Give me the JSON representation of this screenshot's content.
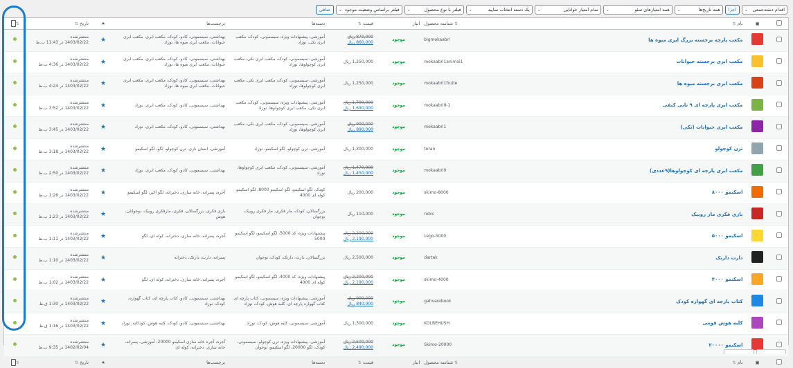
{
  "filters": {
    "bulk_action": "اقدام دسته‌جمعی",
    "apply": "اجرا",
    "dates": "همه تاریخ‌ها",
    "seo_scores": "همه امتیازهای سئو",
    "readability": "تمام امتیاز خوانایی",
    "category": "یک دسته انتخاب نمایید",
    "product_type": "فیلتر با نوع محصول",
    "stock_status": "فیلتر براساس وضعیت موجود",
    "filter_button": "صافی"
  },
  "columns": {
    "name": "نام",
    "sku": "شناسه محصول",
    "stock": "انبار",
    "price": "قیمت",
    "categories": "دسته‌ها",
    "tags": "برچسب‌ها",
    "date": "تاریخ"
  },
  "colors": {
    "accent": "#2271b1",
    "in_stock": "#00a32a",
    "status_dot": "#8bc34a",
    "annotation": "#1a7acb"
  },
  "products": [
    {
      "name": "مکعب پارچه برجسته بزرگ ابری میوه ها",
      "sku": "bigmokaabri",
      "stock": "موجود",
      "old_price": "870,000 ریال",
      "price": "860,000 ریال",
      "categories": "آموزشی، پیشنهادات ویژه، سیسمونی، کودک، مکعب ابری نکی، نوزاد",
      "tags": "بهداشتی، سیسمونی، کادو، کودک، مکعب ابری، مکعب ابری حیوانات، مکعب ابری میوه ها، نوزاد",
      "status": "منتشرشده",
      "date": "1403/02/22 در 11:43 ب.ظ",
      "thumb": "#e53935"
    },
    {
      "name": "مکعب ابری برجسته حیوانات",
      "sku": "mokaabri1animal1",
      "stock": "موجود",
      "old_price": "",
      "price": "1,250,000 ریال",
      "categories": "آموزشی، سیسمونی، کودک، مکعب ابری نکی، مکعب ابری کوچولوها، نوزاد",
      "tags": "بهداشتی، سیسمونی، کادو، کودک، مکعب ابری، مکعب ابری حیوانات، مکعب ابری میوه ها، نوزاد",
      "status": "منتشرشده",
      "date": "1403/02/22 در 4:36 ب.ظ",
      "thumb": "#fbc02d"
    },
    {
      "name": "مکعب ابری برجسته میوه ها",
      "sku": "mokaabri1fruite",
      "stock": "موجود",
      "old_price": "",
      "price": "1,250,000 ریال",
      "categories": "آموزشی، سیسمونی، کودک، مکعب ابری نکی، مکعب ابری کوچولوها، نوزاد",
      "tags": "بهداشتی، سیسمونی، کادو، کودک، مکعب ابری، مکعب ابری حیوانات، مکعب ابری میوه ها، نوزاد",
      "status": "منتشرشده",
      "date": "1403/02/22 در 4:24 ب.ظ",
      "thumb": "#d84315"
    },
    {
      "name": "مکعب ابری پارچه ای ۹ تایی کیفی",
      "sku": "mokaabri9-1",
      "stock": "موجود",
      "old_price": "1,700,000 ریال",
      "price": "1,690,000 ریال",
      "categories": "آموزشی، پیشنهادات ویژه، سیسمونی، کودک، مکعب ابری نکی، مکعب ابری کوچولوها، نوزاد",
      "tags": "بهداشتی، سیسمونی، کادو، کودک، مکعب ابری، نوزاد",
      "status": "منتشرشده",
      "date": "1403/02/22 در 3:52 ب.ظ",
      "thumb": "#7cb342"
    },
    {
      "name": "مکعب ابری حیوانات (نکی)",
      "sku": "mokaabri1",
      "stock": "موجود",
      "old_price": "900,000 ریال",
      "price": "890,000 ریال",
      "categories": "آموزشی، سیسمونی، کودک، مکعب ابری نکی، مکعب ابری کوچولوها، نوزاد",
      "tags": "بهداشتی، سیسمونی، کادو، کودک، مکعب ابری، نوزاد",
      "status": "منتشرشده",
      "date": "1403/02/22 در 3:45 ب.ظ",
      "thumb": "#8e24aa"
    },
    {
      "name": "ترن کوچولو",
      "sku": "teran",
      "stock": "موجود",
      "old_price": "",
      "price": "1,300,000 ریال",
      "categories": "آموزشی، ترن کوچولو، لگو اسکیمو، نوزاد",
      "tags": "آموزشی، انسان بازی، ترن کوچولو، لگو، لگو اسکیمو",
      "status": "منتشرشده",
      "date": "1403/02/22 در 3:18 ب.ظ",
      "thumb": "#90a4ae"
    },
    {
      "name": "مکعب ابری پارچه ای کوچولوها(۹عددی)",
      "sku": "mokaabri9",
      "stock": "موجود",
      "old_price": "1,470,000 ریال",
      "price": "1,450,000 ریال",
      "categories": "آموزشی، سیسمونی، کودک، مکعب ابری کوچولوها، نوزاد",
      "tags": "بهداشتی، سیسمونی، کادو، کودک، مکعب ابری، نوزاد",
      "status": "منتشرشده",
      "date": "1403/02/22 در 2:50 ب.ظ",
      "thumb": "#43a047"
    },
    {
      "name": "اسکیمو ۸۰۰۰",
      "sku": "skimo-8000",
      "stock": "موجود",
      "old_price": "",
      "price": "200,000 ریال",
      "categories": "کودک، لگو اسکیمو، لگو اسکیمو 8000، لگو اسکیمو کوله ای 4000",
      "tags": "آجره، پسرانه، خانه سازی، دخترانه، لگو اکبر، لگو اسکیمو",
      "status": "منتشرشده",
      "date": "1403/02/22 در 1:26 ب.ظ",
      "thumb": "#ef6c00"
    },
    {
      "name": "بازی فکری مار روبیک",
      "sku": "robic",
      "stock": "موجود",
      "old_price": "",
      "price": "110,000 ریال",
      "categories": "بزرگسالان، کودک، مار فکری، مار فکری روبیک، نوجوان",
      "tags": "بازی فکری، بزرگسالان، فکری، مارفکری روبیک، نوجوانان، هوش",
      "status": "منتشرشده",
      "date": "1403/02/22 در 1:23 ب.ظ",
      "thumb": "#c62828"
    },
    {
      "name": "اسکیمو ۵۰۰۰",
      "sku": "Lego-5000",
      "stock": "موجود",
      "old_price": "2,200,000 ریال",
      "price": "2,190,000 ریال",
      "categories": "پیشنهادات ویژه، کد 5000، لگو اسکیمو، لگو اسکیمو 5000",
      "tags": "آجره، پسرانه، خانه سازی، دخترانه، کوله ای، لگو",
      "status": "منتشرشده",
      "date": "1403/02/22 در 1:11 ب.ظ",
      "thumb": "#fdd835"
    },
    {
      "name": "دارت دارتک",
      "sku": "dartak",
      "stock": "موجود",
      "old_price": "",
      "price": "2,500,000 ریال",
      "categories": "بزرگسالان، دارت، دارتک، کودک، نوجوان",
      "tags": "پسرانه، دارت، دارتک، دخترانه",
      "status": "منتشرشده",
      "date": "1403/02/22 در 1:10 ب.ظ",
      "thumb": "#212121"
    },
    {
      "name": "اسکیمو ۴۰۰۰",
      "sku": "skimo-4000",
      "stock": "موجود",
      "old_price": "2,200,000 ریال",
      "price": "2,190,000 ریال",
      "categories": "پیشنهادات ویژه، کد 4000، لگو اسکیمو، لگو اسکیمو کوله ای 4000",
      "tags": "آجره، پسرانه، خانه سازی، دخترانه، کوله ای، لگو",
      "status": "منتشرشده",
      "date": "1403/02/22 در 1:02 ب.ظ",
      "thumb": "#f9a825"
    },
    {
      "name": "کتاب پارچه ای گهواره کودک",
      "sku": "gahvarebook",
      "stock": "موجود",
      "old_price": "900,000 ریال",
      "price": "840,000 ریال",
      "categories": "آموزشی، پیشنهادات ویژه، سیسمونی، کتاب پارچه ای، کتاب گهواره پارچه ای، کلبه هوش، کودک، نوزاد",
      "tags": "بهداشتی، سیسمونی، کادو، کتاب پارچه ای، کتاب گهواره، کودک، نوزاد",
      "status": "منتشرشده",
      "date": "1403/02/22 در 1:30 ق.ظ",
      "thumb": "#1e88e5"
    },
    {
      "name": "کلبه هوش قومی",
      "sku": "KOLBEHUSH",
      "stock": "موجود",
      "old_price": "",
      "price": "1,300,000 ریال",
      "categories": "آموزشی، سیسمونی، کلبه هوش، کودک، نوزاد",
      "tags": "بهداشتی، سیسمونی، کادو، کودک، کلبه هوش، کودکانه، نوزاد",
      "status": "منتشرشده",
      "date": "1403/02/22 در 1:16 ق.ظ",
      "thumb": "#ab47bc"
    },
    {
      "name": "اسکیمو ۲۰۰۰۰",
      "sku": "Skimo-20000",
      "stock": "موجود",
      "old_price": "2,500,000 ریال",
      "price": "2,490,000 ریال",
      "categories": "آموزشی، پیشنهادات ویژه، ترن کوچولو، سیسمونی، کودک، لگو 20000، لگو اسکیمو، نوجوان",
      "tags": "آجره، آجره خانه سازی اسکیمو 20000، آموزشی، پسرانه، خانه سازی، دخترانه، کوله ای",
      "status": "منتشرشده",
      "date": "1402/02/04 در 9:35 ب.ظ",
      "thumb": "#e53935"
    }
  ]
}
